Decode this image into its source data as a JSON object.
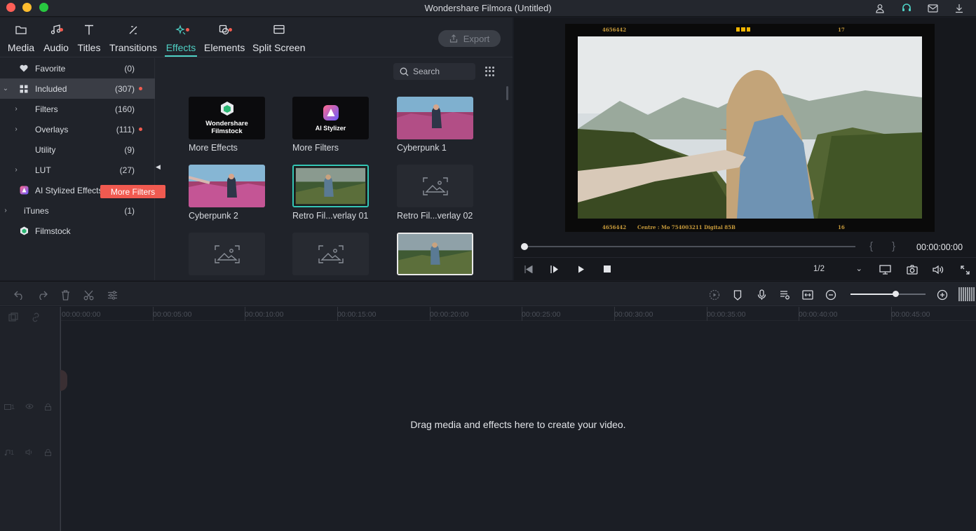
{
  "window": {
    "title": "Wondershare Filmora (Untitled)"
  },
  "titlebar_icons": [
    "account-icon",
    "support-icon",
    "mail-icon",
    "download-icon"
  ],
  "tabs": [
    {
      "label": "Media",
      "icon": "folder-icon",
      "active": false
    },
    {
      "label": "Audio",
      "icon": "music-note-icon",
      "active": false,
      "dot": true
    },
    {
      "label": "Titles",
      "icon": "text-t-icon",
      "active": false
    },
    {
      "label": "Transitions",
      "icon": "transition-icon",
      "active": false
    },
    {
      "label": "Effects",
      "icon": "effects-sparkle-icon",
      "active": true,
      "dot": true
    },
    {
      "label": "Elements",
      "icon": "elements-icon",
      "active": false,
      "dot": true
    },
    {
      "label": "Split Screen",
      "icon": "split-screen-icon",
      "active": false
    }
  ],
  "export_label": "Export",
  "sidebar": {
    "items": [
      {
        "label": "Favorite",
        "count": "(0)",
        "icon": "heart-icon"
      },
      {
        "label": "Included",
        "count": "(307)",
        "icon": "grid-icon",
        "expanded": true,
        "selected": true,
        "dot": true
      },
      {
        "label": "Filters",
        "count": "(160)",
        "chevron": true
      },
      {
        "label": "Overlays",
        "count": "(111)",
        "chevron": true,
        "dot": true
      },
      {
        "label": "Utility",
        "count": "(9)"
      },
      {
        "label": "LUT",
        "count": "(27)",
        "chevron": true
      },
      {
        "label": "AI Stylized Effects",
        "count": "",
        "icon": "ai-stylizer-icon"
      },
      {
        "label": "iTunes",
        "count": "(1)",
        "chevron": true
      },
      {
        "label": "Filmstock",
        "count": "",
        "icon": "filmstock-icon"
      }
    ],
    "tooltip": "More Filters"
  },
  "search": {
    "placeholder": "Search"
  },
  "effects": [
    {
      "label": "More Effects",
      "card_text": "Wondershare Filmstock",
      "kind": "filmstock"
    },
    {
      "label": "More Filters",
      "card_text": "AI Stylizer",
      "kind": "ai"
    },
    {
      "label": "Cyberpunk 1",
      "kind": "photo-pink"
    },
    {
      "label": "Cyberpunk 2",
      "kind": "photo-pink"
    },
    {
      "label": "Retro Fil...verlay 01",
      "kind": "photo-green",
      "selected": true
    },
    {
      "label": "Retro Fil...verlay 02",
      "kind": "placeholder"
    },
    {
      "label": "",
      "kind": "placeholder"
    },
    {
      "label": "",
      "kind": "placeholder"
    },
    {
      "label": "",
      "kind": "photo-green",
      "selected_white": true
    }
  ],
  "preview": {
    "film_text": {
      "tl": "4656442",
      "tr": "17",
      "bl": "4656442",
      "bc": "Centre : Mo 754003211   Digital 85B",
      "br": "16"
    },
    "timecode": "00:00:00:00",
    "ratio": "1/2"
  },
  "timeline": {
    "ruler": [
      "00:00:00:00",
      "00:00:05:00",
      "00:00:10:00",
      "00:00:15:00",
      "00:00:20:00",
      "00:00:25:00",
      "00:00:30:00",
      "00:00:35:00",
      "00:00:40:00",
      "00:00:45:00"
    ],
    "drop_text": "Drag media and effects here to create your video.",
    "video_track": "1",
    "audio_track": "1",
    "zoom_level": 0.6
  },
  "colors": {
    "accent": "#4fd1c5",
    "badge": "#f15b4f",
    "tooltip": "#f05a50"
  }
}
